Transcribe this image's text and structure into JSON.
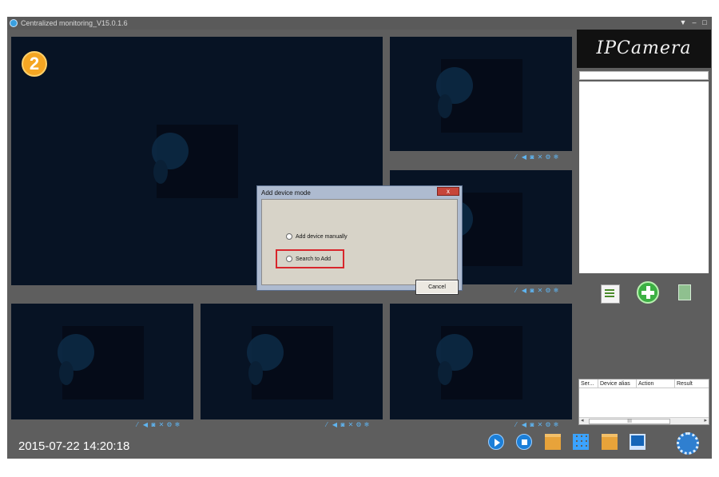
{
  "window": {
    "title": "Centralized monitoring_V15.0.1.6",
    "minimize_label": "–",
    "maximize_label": "□",
    "skin_label": "▼"
  },
  "main_view": {
    "selected_channel": "2"
  },
  "pane_controls": [
    "⁄",
    "◀",
    "◙",
    "✕",
    "⚙",
    "❄"
  ],
  "sidebar": {
    "brand": "IPCamera",
    "result_table": {
      "columns": [
        "Ser...",
        "Device alias",
        "Action",
        "Result"
      ],
      "scroll_left": "◂",
      "scroll_thumb": "III",
      "scroll_right": "▸"
    }
  },
  "dialog": {
    "title": "Add device mode",
    "close_label": "x",
    "option_manual": "Add device manually",
    "option_search": "Search to Add",
    "cancel_label": "Cancel"
  },
  "statusbar": {
    "datetime": "2015-07-22 14:20:18"
  },
  "colors": {
    "frame": "#5e5e5e",
    "video_bg": "#071324",
    "highlight": "#d8262c",
    "badge": "#f5a623"
  },
  "icons": {
    "toolbar": [
      "play-icon",
      "stop-icon",
      "folder-icon",
      "grid-icon",
      "file-icon",
      "monitor-icon",
      "settings-icon"
    ],
    "sidebar": [
      "edit-icon",
      "add-icon",
      "recycle-icon"
    ]
  }
}
